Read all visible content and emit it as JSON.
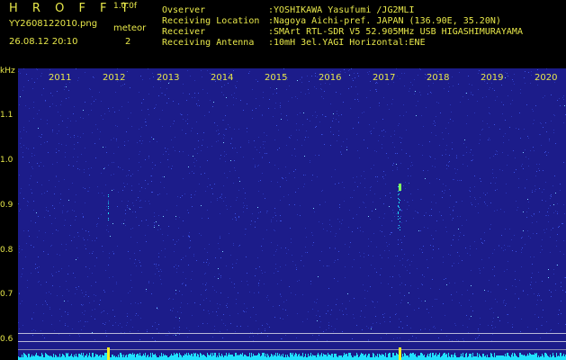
{
  "header": {
    "title": "H R O F F T",
    "version": "1.0.0f",
    "file": "YY2608122010.png",
    "datetime": "26.08.12 20:10",
    "meteor_label": "meteor",
    "meteor_count": "2",
    "info": [
      {
        "key": "Ovserver",
        "value": ":YOSHIKAWA Yasufumi /JG2MLI"
      },
      {
        "key": "Receiving Location",
        "value": ":Nagoya Aichi-pref. JAPAN (136.90E, 35.20N)"
      },
      {
        "key": "Receiver",
        "value": ":SMArt RTL-SDR V5 52.905MHz USB HIGASHIMURAYAMA"
      },
      {
        "key": "Receiving Antenna",
        "value": ":10mH 3el.YAGI Horizontal:ENE"
      }
    ]
  },
  "chart_data": {
    "type": "heatmap",
    "ylabel": "kHz",
    "y_ticks": [
      "1.1",
      "1.0",
      "0.9",
      "0.8",
      "0.7",
      "0.6"
    ],
    "x_ticks": [
      "2011",
      "2012",
      "2013",
      "2014",
      "2015",
      "2016",
      "2017",
      "2018",
      "2019",
      "2020"
    ],
    "colors": {
      "background": "#1c1c8a",
      "noise": "#3a4fe0",
      "signal": "#20e0ff",
      "peak": "#f0f020"
    }
  }
}
